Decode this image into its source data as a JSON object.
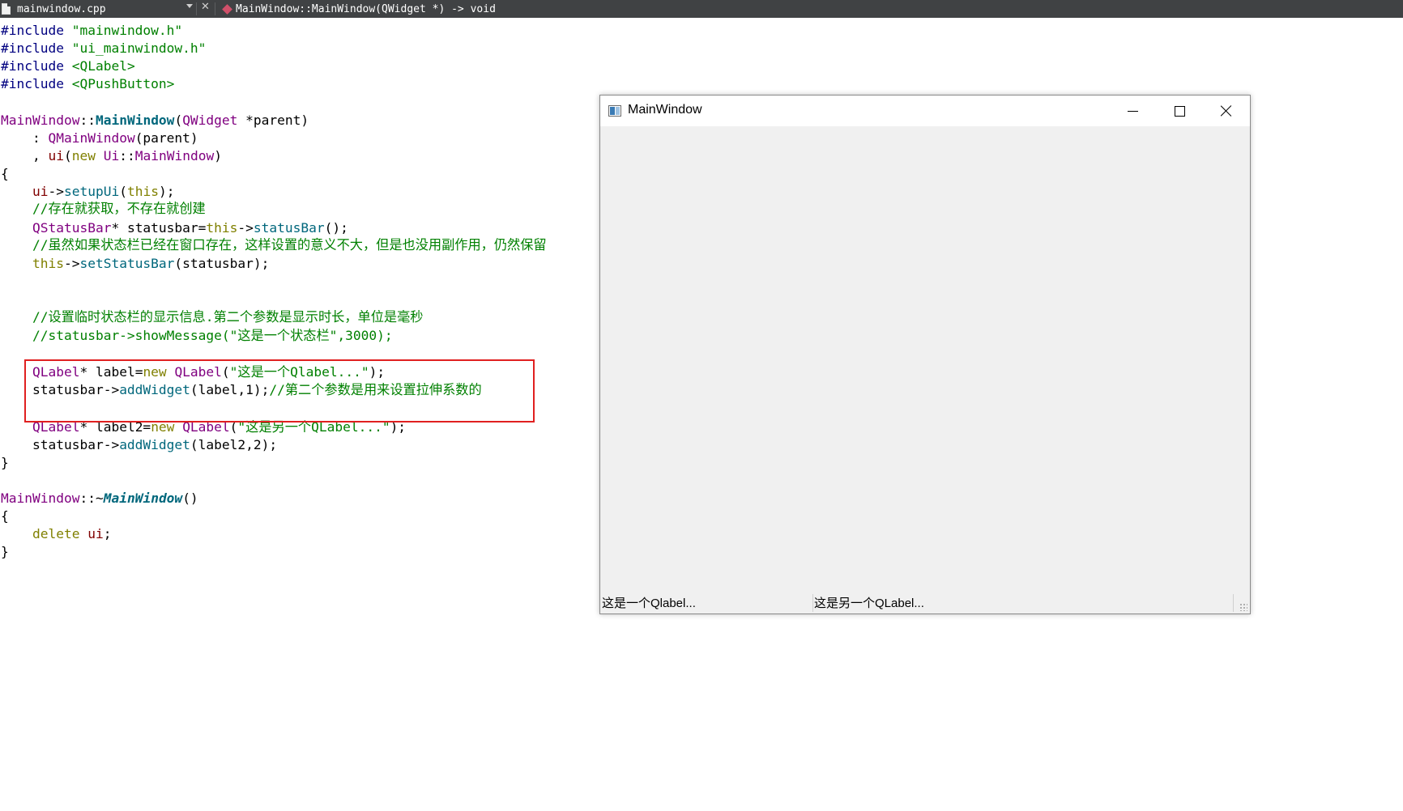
{
  "editor": {
    "tab_filename": "mainwindow.cpp",
    "symbol": "MainWindow::MainWindow(QWidget *) -> void"
  },
  "code": {
    "lines": [
      [
        [
          "#include ",
          "kw-pre"
        ],
        [
          "\"mainwindow.h\"",
          "str"
        ]
      ],
      [
        [
          "#include ",
          "kw-pre"
        ],
        [
          "\"ui_mainwindow.h\"",
          "str"
        ]
      ],
      [
        [
          "#include ",
          "kw-pre"
        ],
        [
          "<QLabel>",
          "str"
        ]
      ],
      [
        [
          "#include ",
          "kw-pre"
        ],
        [
          "<QPushButton>",
          "str"
        ]
      ],
      [],
      [
        [
          "MainWindow",
          "cls"
        ],
        [
          "::",
          ""
        ],
        [
          "MainWindow",
          "bold-fn"
        ],
        [
          "(",
          ""
        ],
        [
          "QWidget",
          "cls"
        ],
        [
          " *parent)",
          ""
        ]
      ],
      [
        [
          "    : ",
          ""
        ],
        [
          "QMainWindow",
          "cls"
        ],
        [
          "(parent)",
          ""
        ]
      ],
      [
        [
          "    , ",
          ""
        ],
        [
          "ui",
          "member"
        ],
        [
          "(",
          ""
        ],
        [
          "new",
          "kw"
        ],
        [
          " ",
          ""
        ],
        [
          "Ui",
          "cls"
        ],
        [
          "::",
          ""
        ],
        [
          "MainWindow",
          "cls"
        ],
        [
          ")",
          ""
        ]
      ],
      [
        [
          "{",
          ""
        ]
      ],
      [
        [
          "    ",
          ""
        ],
        [
          "ui",
          "member"
        ],
        [
          "->",
          ""
        ],
        [
          "setupUi",
          "fn"
        ],
        [
          "(",
          ""
        ],
        [
          "this",
          "kw"
        ],
        [
          ");",
          ""
        ]
      ],
      [
        [
          "    //存在就获取，不存在就创建",
          "cmt"
        ]
      ],
      [
        [
          "    ",
          ""
        ],
        [
          "QStatusBar",
          "cls"
        ],
        [
          "* statusbar=",
          ""
        ],
        [
          "this",
          "kw"
        ],
        [
          "->",
          ""
        ],
        [
          "statusBar",
          "fn"
        ],
        [
          "();",
          ""
        ]
      ],
      [
        [
          "    //虽然如果状态栏已经在窗口存在，这样设置的意义不大，但是也没用副作用，仍然保留",
          "cmt"
        ]
      ],
      [
        [
          "    ",
          ""
        ],
        [
          "this",
          "kw"
        ],
        [
          "->",
          ""
        ],
        [
          "setStatusBar",
          "fn"
        ],
        [
          "(statusbar);",
          ""
        ]
      ],
      [],
      [],
      [
        [
          "    //设置临时状态栏的显示信息.第二个参数是显示时长，单位是毫秒",
          "cmt"
        ]
      ],
      [
        [
          "    //statusbar->showMessage(\"这是一个状态栏\",3000);",
          "cmt"
        ]
      ],
      [],
      [
        [
          "    ",
          ""
        ],
        [
          "QLabel",
          "cls"
        ],
        [
          "* label=",
          ""
        ],
        [
          "new",
          "kw"
        ],
        [
          " ",
          ""
        ],
        [
          "QLabel",
          "cls"
        ],
        [
          "(",
          ""
        ],
        [
          "\"这是一个Qlabel...\"",
          "str"
        ],
        [
          ");",
          ""
        ]
      ],
      [
        [
          "    statusbar->",
          ""
        ],
        [
          "addWidget",
          "fn"
        ],
        [
          "(label,1);",
          ""
        ],
        [
          "//第二个参数是用来设置拉伸系数的",
          "cmt"
        ]
      ],
      [],
      [
        [
          "    ",
          ""
        ],
        [
          "QLabel",
          "cls"
        ],
        [
          "* label2=",
          ""
        ],
        [
          "new",
          "kw"
        ],
        [
          " ",
          ""
        ],
        [
          "QLabel",
          "cls"
        ],
        [
          "(",
          ""
        ],
        [
          "\"这是另一个QLabel...\"",
          "str"
        ],
        [
          ");",
          ""
        ]
      ],
      [
        [
          "    statusbar->",
          ""
        ],
        [
          "addWidget",
          "fn"
        ],
        [
          "(label2,2);",
          ""
        ]
      ],
      [
        [
          "}",
          ""
        ]
      ],
      [],
      [
        [
          "MainWindow",
          "cls"
        ],
        [
          "::~",
          ""
        ],
        [
          "MainWindow",
          "ital-fn"
        ],
        [
          "()",
          ""
        ]
      ],
      [
        [
          "{",
          ""
        ]
      ],
      [
        [
          "    ",
          ""
        ],
        [
          "delete",
          "kw"
        ],
        [
          " ",
          ""
        ],
        [
          "ui",
          "member"
        ],
        [
          ";",
          ""
        ]
      ],
      [
        [
          "}",
          ""
        ]
      ]
    ]
  },
  "qt_window": {
    "title": "MainWindow",
    "status_label_1": "这是一个Qlabel...",
    "status_label_2": "这是另一个QLabel..."
  }
}
